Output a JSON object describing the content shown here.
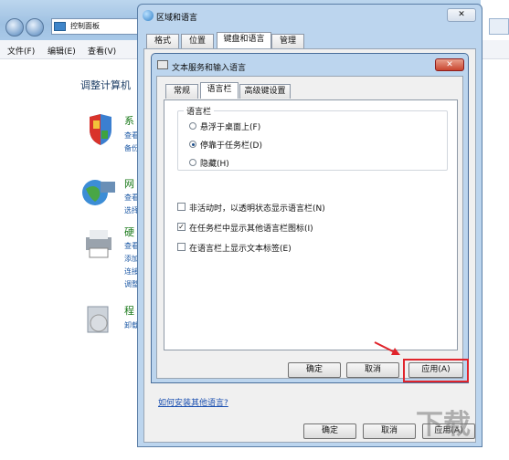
{
  "control_panel": {
    "breadcrumb": "控制面板",
    "menu": [
      "文件(F)",
      "编辑(E)",
      "查看(V)"
    ],
    "heading": "调整计算机",
    "categories": [
      {
        "title": "系",
        "links": [
          "查看",
          "备份"
        ]
      },
      {
        "title": "网",
        "links": [
          "查看",
          "选择"
        ]
      },
      {
        "title": "硬",
        "links": [
          "查看",
          "添加",
          "连接",
          "调整"
        ]
      },
      {
        "title": "程",
        "links": [
          "卸载"
        ]
      }
    ]
  },
  "region_dialog": {
    "title": "区域和语言",
    "close": "✕",
    "tabs": [
      "格式",
      "位置",
      "键盘和语言",
      "管理"
    ],
    "active_tab": "键盘和语言",
    "help_link": "如何安装其他语言?",
    "buttons": {
      "ok": "确定",
      "cancel": "取消",
      "apply": "应用(A)"
    }
  },
  "text_services_dialog": {
    "title": "文本服务和输入语言",
    "close": "✕",
    "tabs": [
      "常规",
      "语言栏",
      "高级键设置"
    ],
    "active_tab": "语言栏",
    "group_label": "语言栏",
    "radios": [
      {
        "label": "悬浮于桌面上(F)",
        "checked": false
      },
      {
        "label": "停靠于任务栏(D)",
        "checked": true
      },
      {
        "label": "隐藏(H)",
        "checked": false
      }
    ],
    "checkboxes": [
      {
        "label": "非活动时，以透明状态显示语言栏(N)",
        "checked": false
      },
      {
        "label": "在任务栏中显示其他语言栏图标(I)",
        "checked": true
      },
      {
        "label": "在语言栏上显示文本标签(E)",
        "checked": false
      }
    ],
    "buttons": {
      "ok": "确定",
      "cancel": "取消",
      "apply": "应用(A)"
    }
  },
  "colors": {
    "highlight": "#e0242b",
    "arrow": "#e0242b"
  }
}
